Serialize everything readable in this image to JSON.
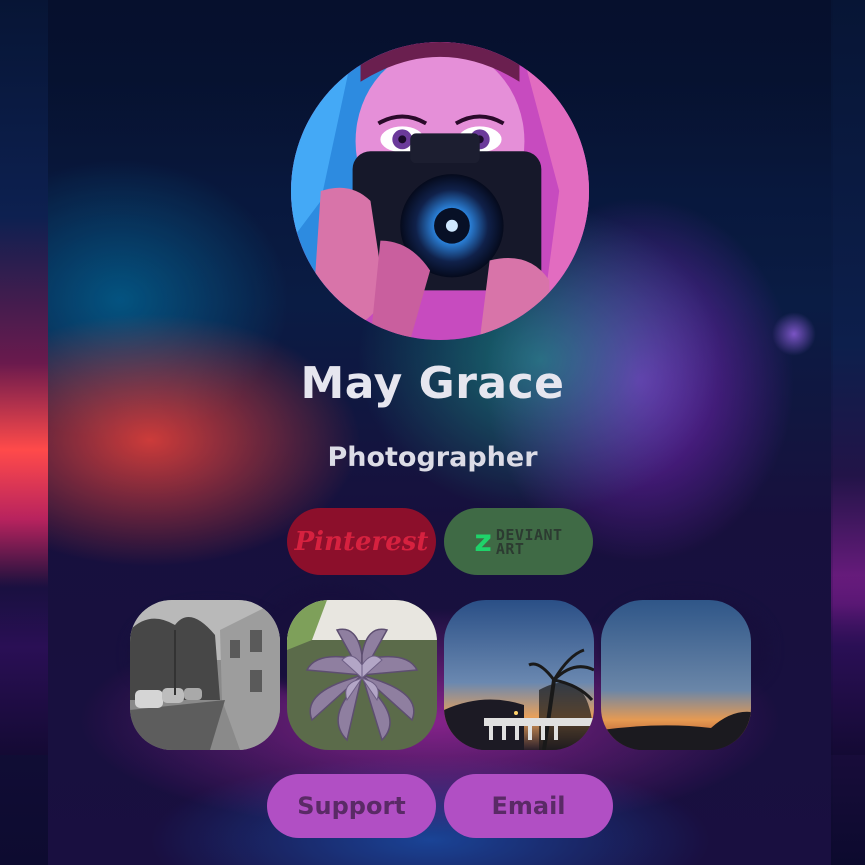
{
  "profile": {
    "name": "May Grace",
    "role": "Photographer"
  },
  "social": {
    "pinterest_label": "Pinterest",
    "deviantart_label_1": "DEVIANT",
    "deviantart_label_2": "ART"
  },
  "gallery": [
    {
      "subject": "street-bw"
    },
    {
      "subject": "succulent"
    },
    {
      "subject": "sunset-palm"
    },
    {
      "subject": "sunset-sky"
    }
  ],
  "actions": {
    "support_label": "Support",
    "email_label": "Email"
  },
  "colors": {
    "pinterest": "#8c0f2b",
    "deviantart": "#3f6a45",
    "action": "#b14fc4"
  }
}
